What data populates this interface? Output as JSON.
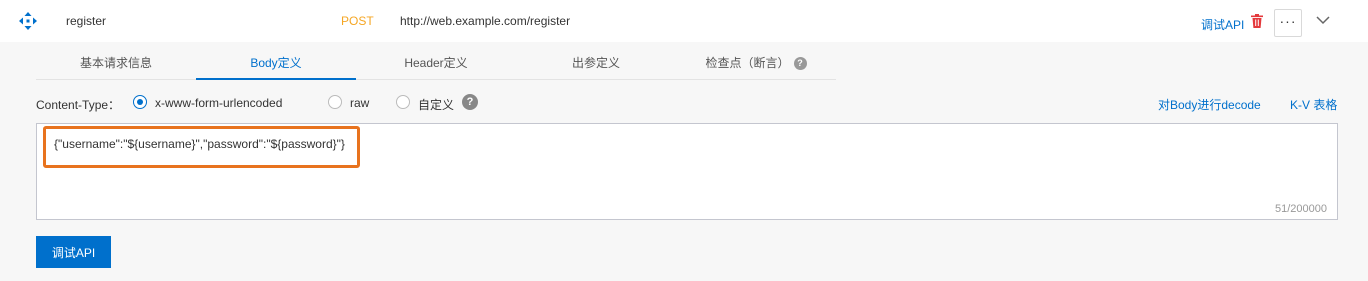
{
  "header": {
    "api_name": "register",
    "method": "POST",
    "url": "http://web.example.com/register",
    "debug_link": "调试API",
    "more_label": "···",
    "method_color": "#f5a623",
    "delete_icon": "trash-icon",
    "expand_icon": "chevron-down-icon",
    "drag_icon": "move-icon"
  },
  "tabs": [
    {
      "label": "基本请求信息",
      "active": false
    },
    {
      "label": "Body定义",
      "active": true
    },
    {
      "label": "Header定义",
      "active": false
    },
    {
      "label": "出参定义",
      "active": false
    },
    {
      "label": "检查点（断言）",
      "active": false,
      "help": "?"
    }
  ],
  "content_type": {
    "label": "Content-Type：",
    "options": [
      {
        "label": "x-www-form-urlencoded",
        "checked": true
      },
      {
        "label": "raw",
        "checked": false
      },
      {
        "label": "自定义",
        "checked": false
      }
    ],
    "help": "?"
  },
  "links": {
    "decode": "对Body进行decode",
    "kv_table": "K-V 表格"
  },
  "editor": {
    "value": "{\"username\":\"${username}\",\"password\":\"${password}\"}",
    "char_count": "51/200000"
  },
  "actions": {
    "debug_button": "调试API"
  },
  "colors": {
    "accent": "#0070cc",
    "highlight": "#e8731e"
  }
}
